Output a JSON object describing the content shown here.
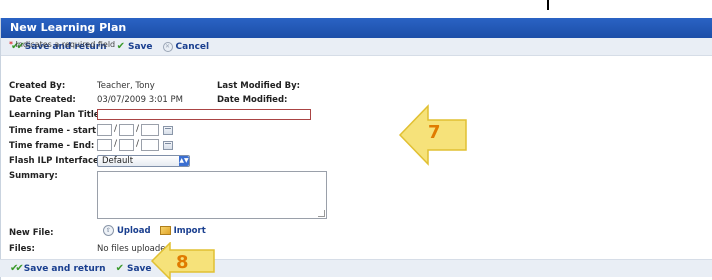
{
  "window": {
    "title": "New Learning Plan"
  },
  "toolbar": {
    "save_and_return": "Save and return",
    "save": "Save",
    "cancel": "Cancel"
  },
  "required_note": {
    "star": "*",
    "text": " Indicates a required field"
  },
  "meta": {
    "created_by_label": "Created By:",
    "created_by_value": "Teacher, Tony",
    "last_modified_by_label": "Last Modified By:",
    "last_modified_by_value": "",
    "date_created_label": "Date Created:",
    "date_created_value": "03/07/2009 3:01 PM",
    "date_modified_label": "Date Modified:",
    "date_modified_value": ""
  },
  "form": {
    "title_label": "Learning Plan Title:",
    "title_required_mark": "*",
    "title_value": "",
    "timeframe_start_label": "Time frame - start:",
    "timeframe_end_label": "Time frame - End:",
    "date_separator": "/",
    "flash_label": "Flash ILP Interface:",
    "flash_selected": "Default",
    "summary_label": "Summary:",
    "summary_value": "",
    "new_file_label": "New File:",
    "upload": "Upload",
    "import": "Import",
    "files_label": "Files:",
    "files_value": "No files uploaded"
  },
  "footer": {
    "save_and_return": "Save and return",
    "save": "Save"
  },
  "callouts": [
    {
      "number": "7",
      "color": "#f2d44a",
      "direction": "left"
    },
    {
      "number": "8",
      "color": "#f2d44a",
      "direction": "left"
    }
  ]
}
